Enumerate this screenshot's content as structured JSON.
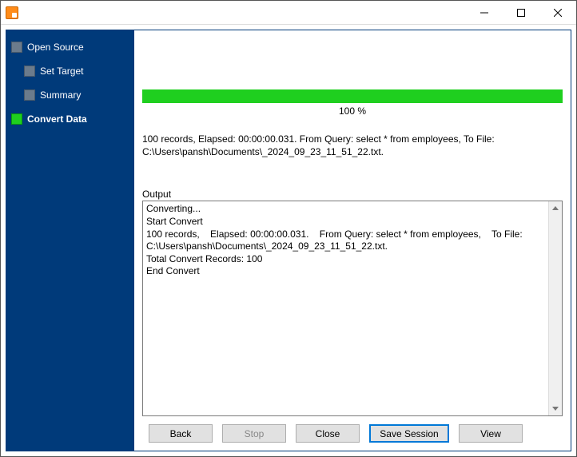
{
  "sidebar": {
    "root": {
      "label": "Open Source",
      "active": false
    },
    "children": [
      {
        "label": "Set Target",
        "active": false,
        "current": false
      },
      {
        "label": "Summary",
        "active": false,
        "current": false
      },
      {
        "label": "Convert Data",
        "active": true,
        "current": true
      }
    ]
  },
  "progress": {
    "percent_label": "100 %",
    "bar_color": "#1fcf1f"
  },
  "summary_text": "100 records,    Elapsed: 00:00:00.031.    From Query: select * from employees,    To File: C:\\Users\\pansh\\Documents\\_2024_09_23_11_51_22.txt.",
  "output": {
    "label": "Output",
    "text": "Converting...\nStart Convert\n100 records,    Elapsed: 00:00:00.031.    From Query: select * from employees,    To File: C:\\Users\\pansh\\Documents\\_2024_09_23_11_51_22.txt.\nTotal Convert Records: 100\nEnd Convert"
  },
  "buttons": {
    "back": "Back",
    "stop": "Stop",
    "close": "Close",
    "save_session": "Save Session",
    "view": "View"
  }
}
